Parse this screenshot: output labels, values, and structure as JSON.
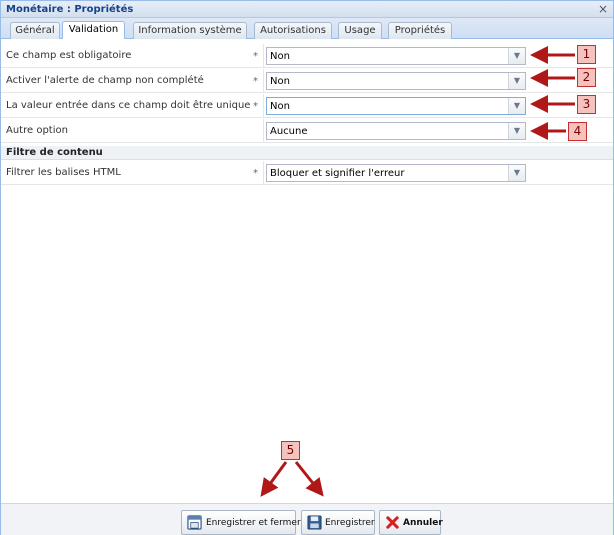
{
  "window": {
    "title": "Monétaire : Propriétés",
    "close_glyph": "×"
  },
  "tabs": [
    {
      "label": "Général",
      "active": false
    },
    {
      "label": "Validation",
      "active": true
    },
    {
      "label": "Information système",
      "active": false
    },
    {
      "label": "Autorisations",
      "active": false
    },
    {
      "label": "Usage",
      "active": false
    },
    {
      "label": "Propriétés",
      "active": false
    }
  ],
  "fields": [
    {
      "label": "Ce champ est obligatoire",
      "required_mark": "*",
      "value": "Non"
    },
    {
      "label": "Activer l'alerte de champ non complété",
      "required_mark": "*",
      "value": "Non"
    },
    {
      "label": "La valeur entrée dans ce champ doit être unique",
      "required_mark": "*",
      "value": "Non"
    },
    {
      "label": "Autre option",
      "required_mark": "",
      "value": "Aucune"
    }
  ],
  "section": {
    "title": "Filtre de contenu",
    "fields": [
      {
        "label": "Filtrer les balises HTML",
        "required_mark": "*",
        "value": "Bloquer et signifier l'erreur"
      }
    ]
  },
  "footer": {
    "buttons": [
      {
        "label": "Enregistrer et fermer",
        "icon": "save-close-icon"
      },
      {
        "label": "Enregistrer",
        "icon": "floppy-disk-icon"
      },
      {
        "label": "Annuler",
        "icon": "red-x-icon"
      }
    ]
  },
  "annotations": {
    "callouts": [
      "1",
      "2",
      "3",
      "4",
      "5"
    ],
    "colors": {
      "arrow": "#b01818",
      "callout_fill": "#f6c2bd",
      "callout_border": "#c43030"
    }
  },
  "colors": {
    "title_text": "#15428b",
    "tab_border": "#99bbe8",
    "cancel_red": "#d42020"
  }
}
